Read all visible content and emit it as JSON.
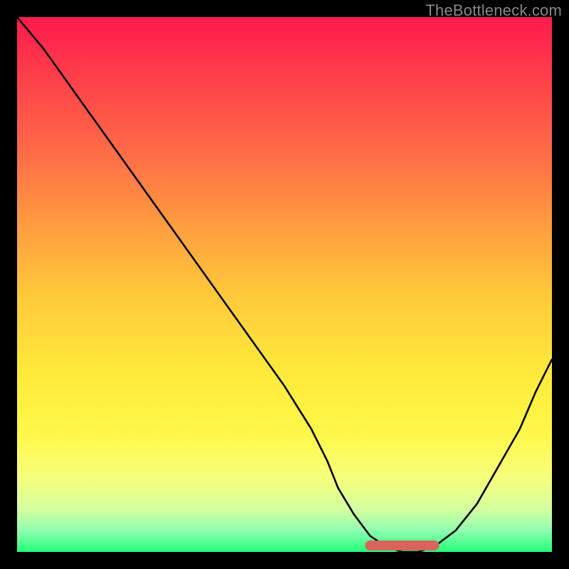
{
  "watermark": "TheBottleneck.com",
  "chart_data": {
    "type": "line",
    "title": "",
    "xlabel": "",
    "ylabel": "",
    "xlim": [
      0,
      100
    ],
    "ylim": [
      0,
      100
    ],
    "series": [
      {
        "name": "bottleneck-curve",
        "x": [
          0,
          5,
          10,
          15,
          20,
          25,
          30,
          35,
          40,
          45,
          50,
          55,
          58,
          60,
          63,
          66,
          69,
          72,
          75,
          78,
          82,
          86,
          90,
          94,
          97,
          100
        ],
        "y": [
          100,
          94,
          87,
          80,
          73,
          66,
          59,
          52,
          45,
          38,
          31,
          23,
          17,
          12,
          7,
          3,
          1,
          0,
          0,
          1,
          4,
          9,
          16,
          23,
          30,
          36
        ]
      },
      {
        "name": "optimal-range-marker",
        "x": [
          66,
          78
        ],
        "y": [
          1.2,
          1.2
        ]
      }
    ],
    "colors": {
      "curve": "#000000",
      "marker": "#d9645e",
      "gradient_top": "#ff1a4d",
      "gradient_bottom": "#22ff77"
    }
  }
}
